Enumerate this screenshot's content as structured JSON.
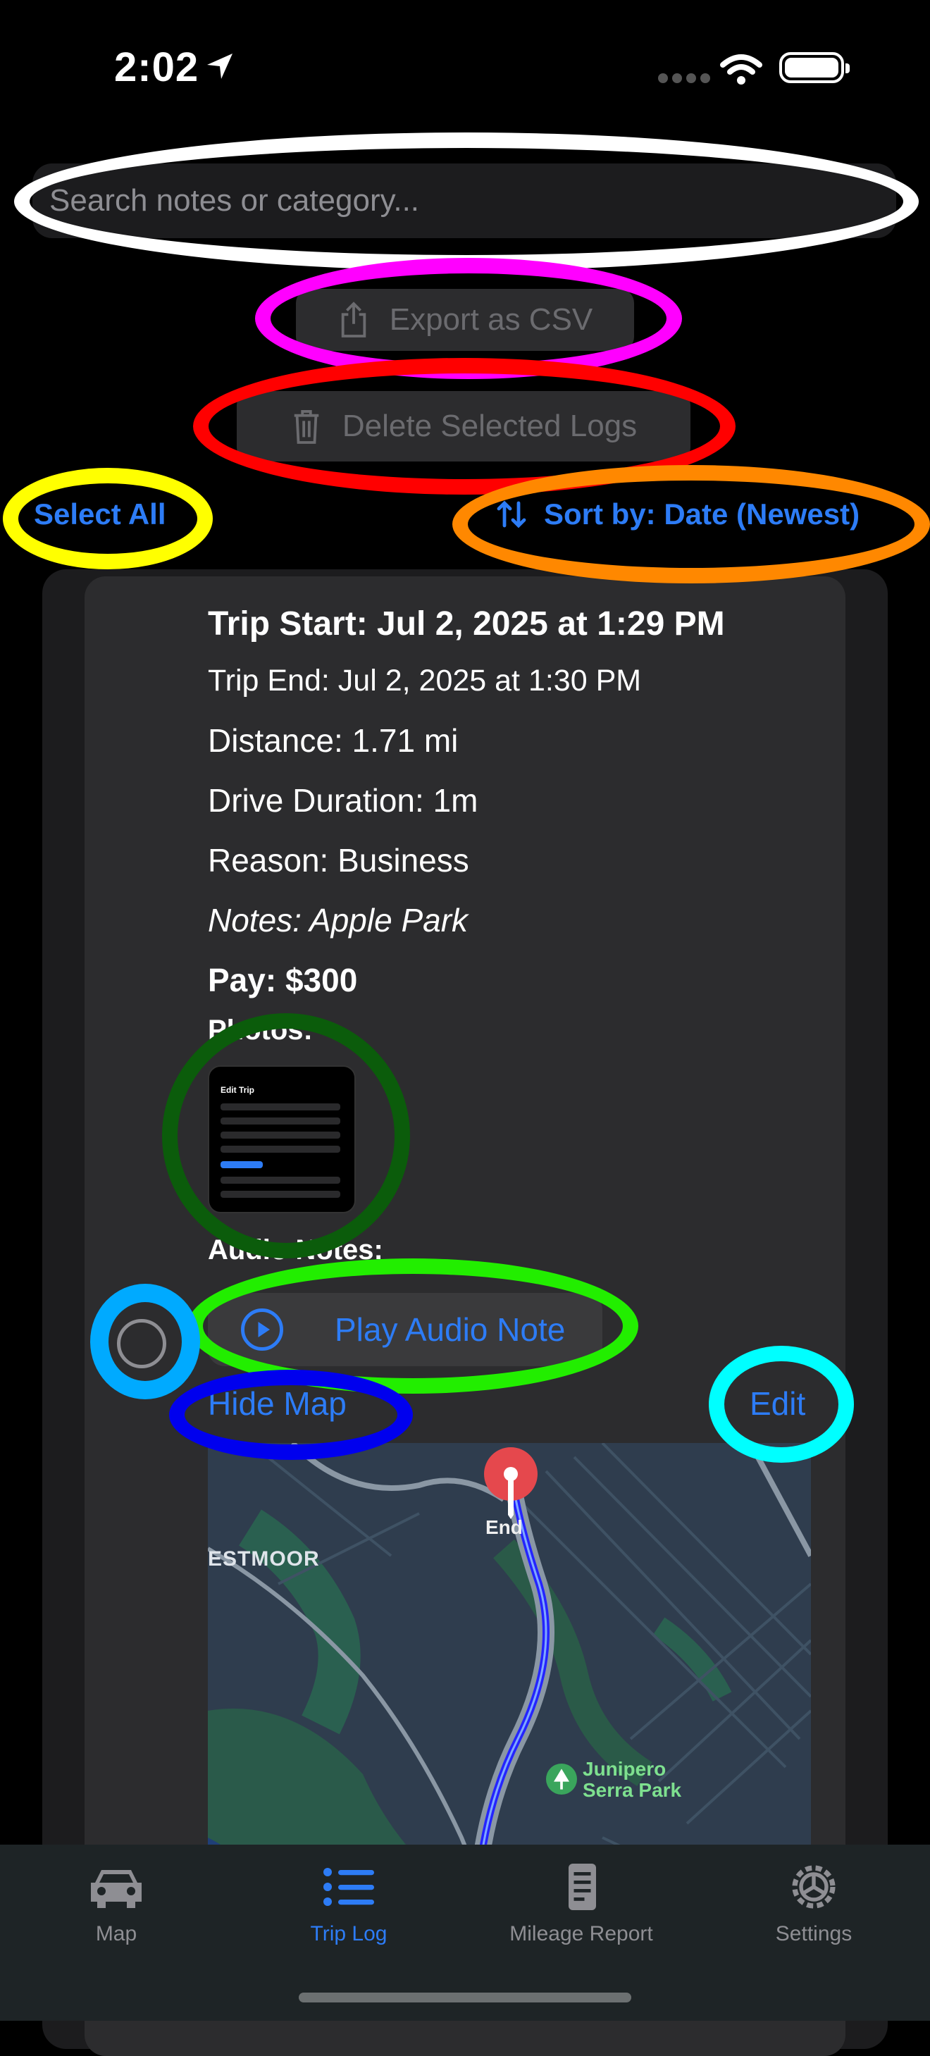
{
  "status_bar": {
    "time": "2:02"
  },
  "search": {
    "placeholder": "Search notes or category..."
  },
  "actions": {
    "export_label": "Export as CSV",
    "delete_label": "Delete Selected Logs",
    "select_all_label": "Select All",
    "sort_label": "Sort by: Date (Newest)"
  },
  "trip": {
    "start": "Trip Start: Jul 2, 2025 at 1:29 PM",
    "end": "Trip End: Jul 2, 2025 at 1:30 PM",
    "distance": "Distance: 1.71 mi",
    "duration": "Drive Duration: 1m",
    "reason": "Reason: Business",
    "notes": "Notes: Apple Park",
    "pay": "Pay: $300",
    "photos_label": "Photos:",
    "audio_label": "Audio Notes:",
    "play_audio_label": "Play Audio Note",
    "hide_map_label": "Hide Map",
    "edit_label": "Edit"
  },
  "map": {
    "end_label": "End",
    "area_label": "ESTMOOR",
    "park_label": "Junipero Serra Park"
  },
  "tab_bar": {
    "tabs": [
      {
        "label": "Map",
        "icon": "car-icon",
        "active": false
      },
      {
        "label": "Trip Log",
        "icon": "list-icon",
        "active": true
      },
      {
        "label": "Mileage Report",
        "icon": "document-icon",
        "active": false
      },
      {
        "label": "Settings",
        "icon": "gear-icon",
        "active": false
      }
    ]
  },
  "colors": {
    "accent": "#2d7cf6",
    "annotation_white": "#ffffff",
    "annotation_magenta": "#ff00ff",
    "annotation_red": "#ff0000",
    "annotation_yellow": "#ffff00",
    "annotation_orange": "#ff8800",
    "annotation_dark_green": "#0b5c0b",
    "annotation_green": "#22ee00",
    "annotation_light_blue": "#00aaff",
    "annotation_blue": "#0000ee",
    "annotation_cyan": "#00ffff"
  }
}
